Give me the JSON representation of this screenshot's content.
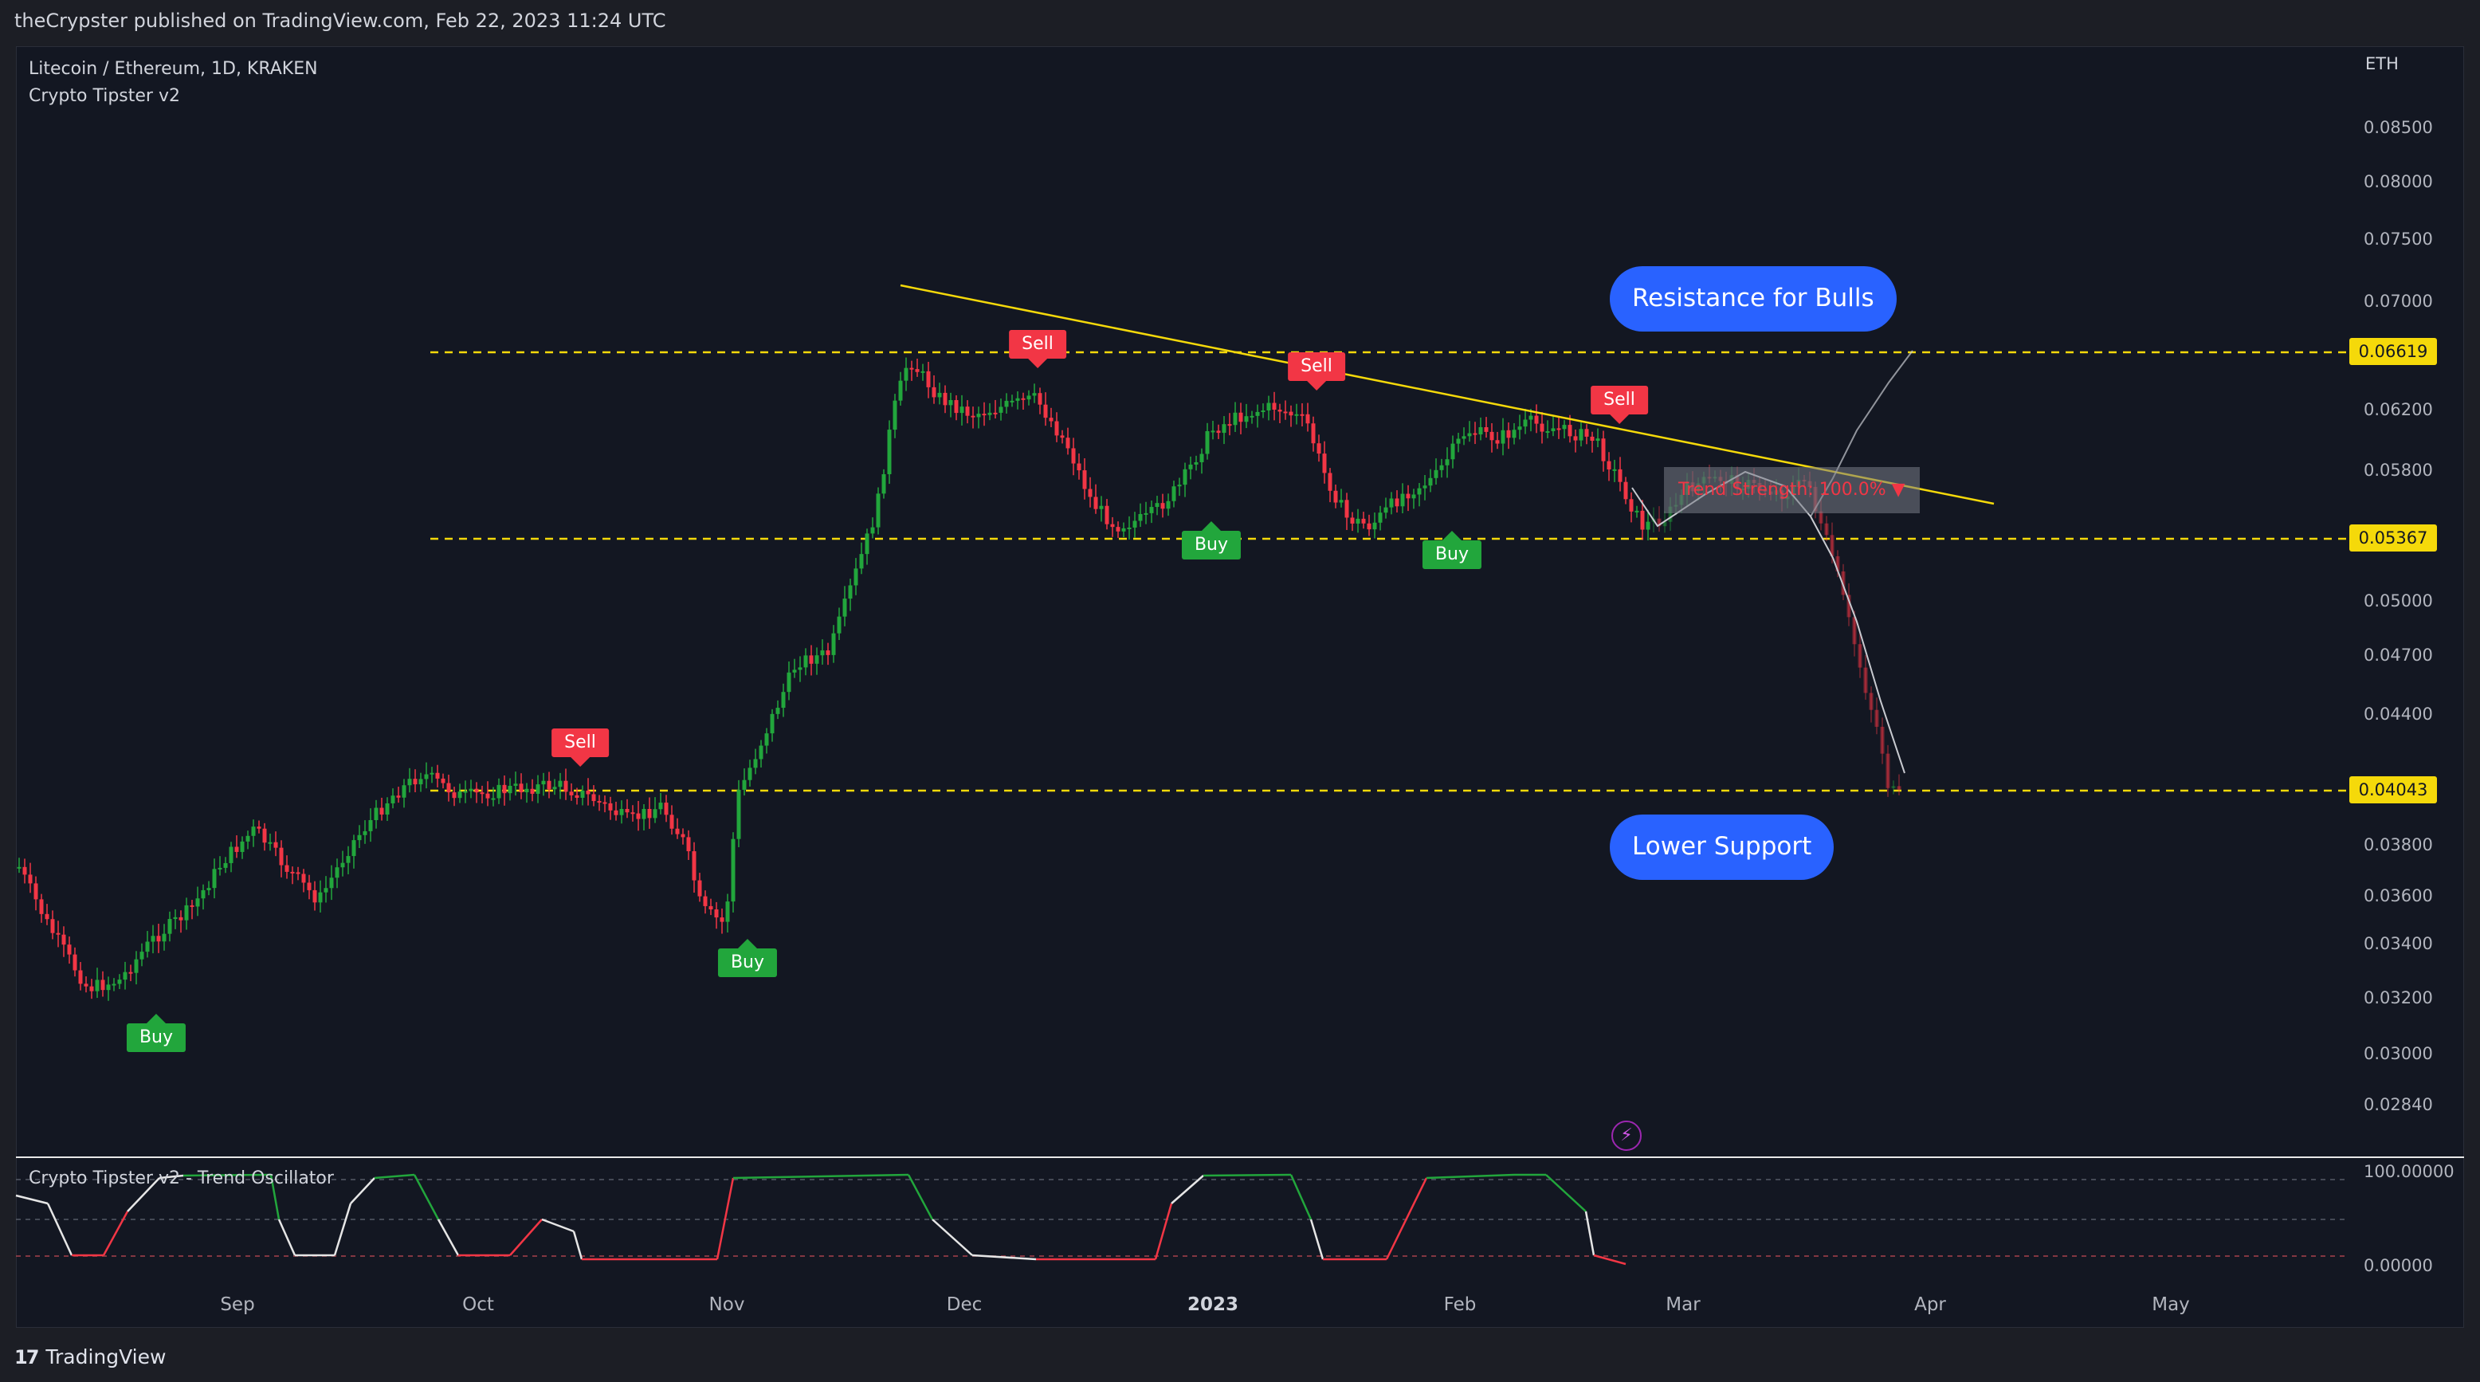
{
  "header": {
    "published": "theCrypster published on TradingView.com, Feb 22, 2023 11:24 UTC"
  },
  "legend": {
    "symbol": "Litecoin / Ethereum, 1D, KRAKEN",
    "indicator": "Crypto Tipster v2"
  },
  "price_axis": {
    "currency": "ETH",
    "labels": [
      "0.08500",
      "0.08000",
      "0.07500",
      "0.07000",
      "0.06200",
      "0.05800",
      "0.05000",
      "0.04700",
      "0.04400",
      "0.03800",
      "0.03600",
      "0.03400",
      "0.03200",
      "0.03000",
      "0.02840"
    ],
    "tags": [
      "0.06619",
      "0.05367",
      "0.04043"
    ]
  },
  "time_axis": {
    "labels": [
      "Sep",
      "Oct",
      "Nov",
      "Dec",
      "2023",
      "Feb",
      "Mar",
      "Apr",
      "May"
    ]
  },
  "annotations": {
    "resistance_label": "Resistance for Bulls",
    "support_label": "Lower Support",
    "trend_strength": "Trend Strength: 100.0% ▼"
  },
  "signals": {
    "sell_label": "Sell",
    "buy_label": "Buy",
    "list": [
      "Sell",
      "Sell",
      "Sell",
      "Sell",
      "Buy",
      "Buy",
      "Buy",
      "Buy"
    ]
  },
  "oscillator": {
    "title": "Crypto Tipster v2 - Trend Oscillator",
    "labels": [
      "100.00000",
      "0.00000"
    ]
  },
  "footer": {
    "brand": "TradingView"
  },
  "colors": {
    "background": "#131722",
    "bull": "#22a63c",
    "bear": "#f23645",
    "level": "#f5d90a",
    "bubble": "#2962ff"
  },
  "icons": [
    "bolt-icon",
    "tradingview-logo-icon",
    "sell-arrow-icon",
    "buy-arrow-icon"
  ]
}
